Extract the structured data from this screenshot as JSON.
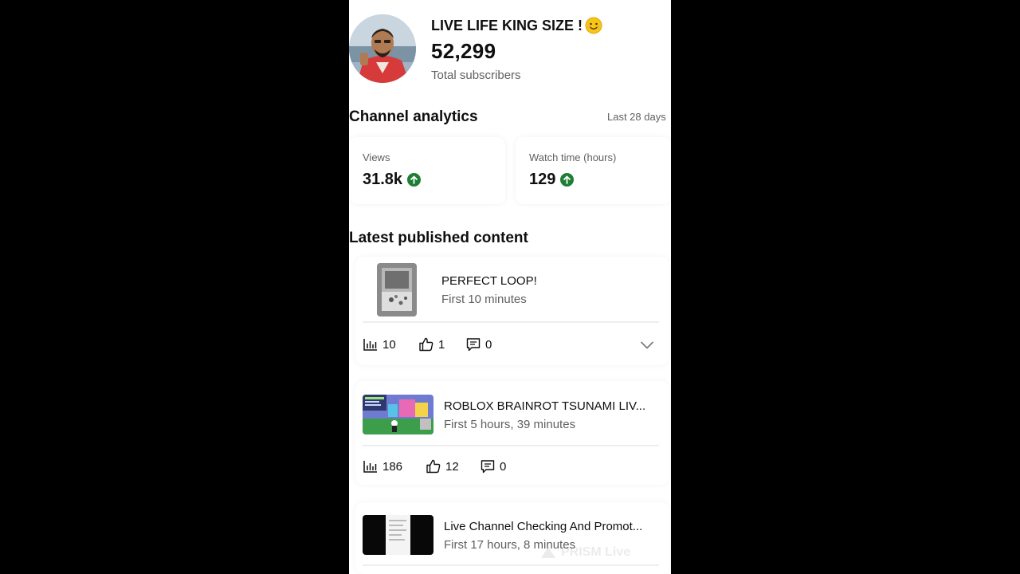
{
  "channel": {
    "name": "LIVE LIFE KING SIZE !",
    "subscriber_count": "52,299",
    "subscriber_label": "Total subscribers"
  },
  "analytics": {
    "title": "Channel analytics",
    "range": "Last 28 days",
    "metrics": [
      {
        "label": "Views",
        "value": "31.8k",
        "trend": "up"
      },
      {
        "label": "Watch time (hours)",
        "value": "129",
        "trend": "up"
      }
    ]
  },
  "latest": {
    "title": "Latest published content",
    "items": [
      {
        "title": "PERFECT LOOP!",
        "subtitle": "First 10 minutes",
        "views": "10",
        "likes": "1",
        "comments": "0"
      },
      {
        "title": "ROBLOX BRAINROT TSUNAMI LIV...",
        "subtitle": "First 5 hours, 39 minutes",
        "views": "186",
        "likes": "12",
        "comments": "0"
      },
      {
        "title": "Live Channel Checking And Promot...",
        "subtitle": "First 17 hours, 8 minutes"
      }
    ]
  },
  "watermark": "PRISM Live",
  "colors": {
    "trend_up": "#1e7e34",
    "secondary_text": "#606060"
  }
}
